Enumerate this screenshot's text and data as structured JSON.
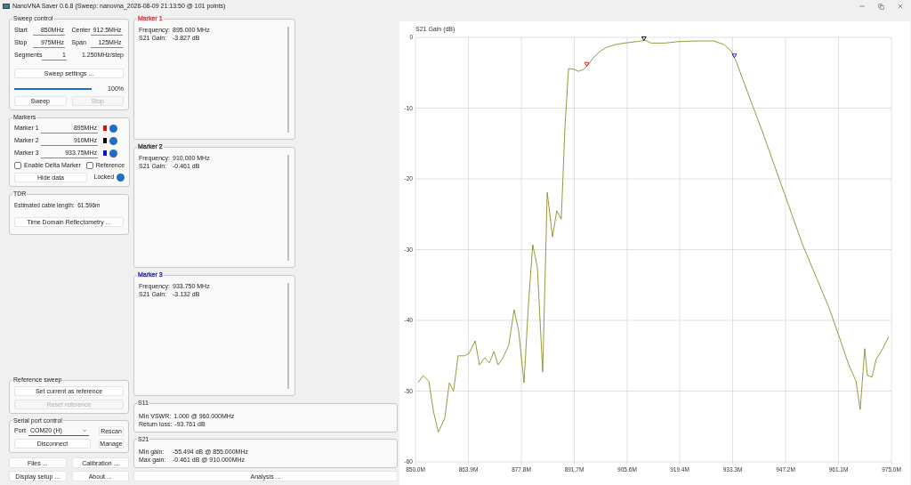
{
  "window": {
    "title": "NanoVNA Saver 0.6.8 (Sweep: nanovna_2026-08-09 21:13:50 @ 101 points)"
  },
  "sweep_control": {
    "title": "Sweep control",
    "fields": [
      {
        "label": "Start",
        "value": "850MHz"
      },
      {
        "label": "Center",
        "value": "912.5MHz"
      },
      {
        "label": "Stop",
        "value": "975MHz"
      },
      {
        "label": "Span",
        "value": "125MHz"
      }
    ],
    "segments": {
      "label": "Segments",
      "value": "1",
      "step": "1.250MHz/step"
    },
    "settings_button": "Sweep settings ...",
    "progress": {
      "level": 1,
      "reading": "100%"
    },
    "buttons": [
      {
        "label": "Sweep",
        "disabled": false
      },
      {
        "label": "Stop",
        "disabled": true
      }
    ]
  },
  "markers": {
    "title": "Markers",
    "items": [
      {
        "label": "Marker 1",
        "value": "895MHz",
        "color": "#e01010"
      },
      {
        "label": "Marker 2",
        "value": "910MHz",
        "color": "#000000"
      },
      {
        "label": "Marker 3",
        "value": "933.75MHz",
        "color": "#1010d0"
      }
    ],
    "checkboxes": [
      {
        "label": "Enable Delta Marker",
        "checked": false
      },
      {
        "label": "Reference",
        "checked": false
      }
    ],
    "hide_button": "Hide data",
    "locked_label": "Locked"
  },
  "tdr": {
    "title": "TDR",
    "text": "Estimated cable length:  61.596m",
    "button": "Time Domain Reflectometry ..."
  },
  "reference_sweep": {
    "title": "Reference sweep",
    "buttons": [
      {
        "label": "Set current as reference",
        "disabled": false
      },
      {
        "label": "Reset reference",
        "disabled": true
      }
    ]
  },
  "serial_port": {
    "title": "Serial port control",
    "port_label": "Port",
    "port_value": "COM20 (H)",
    "buttons": [
      "Rescan",
      "Disconnect",
      "Manage"
    ]
  },
  "bottom_buttons": [
    "Files ...",
    "Calibration ...",
    "Display setup ...",
    "About ..."
  ],
  "marker_panels": [
    {
      "title": "Marker 1",
      "color": "#e04040",
      "rows": [
        {
          "label": "Frequency:",
          "value": "895.000 MHz"
        },
        {
          "label": "S21 Gain:",
          "value": "-3.827 dB"
        }
      ]
    },
    {
      "title": "Marker 2",
      "color": "#404040",
      "rows": [
        {
          "label": "Frequency:",
          "value": "910.000 MHz"
        },
        {
          "label": "S21 Gain:",
          "value": "-0.461 dB"
        }
      ]
    },
    {
      "title": "Marker 3",
      "color": "#3030b0",
      "rows": [
        {
          "label": "Frequency:",
          "value": "933.750 MHz"
        },
        {
          "label": "S21 Gain:",
          "value": "-3.132 dB"
        }
      ]
    }
  ],
  "s11": {
    "title": "S11",
    "rows": [
      {
        "label": "Min VSWR:",
        "value": "1.000 @ 960.000MHz"
      },
      {
        "label": "Return loss:",
        "value": "-93.761 dB"
      }
    ]
  },
  "s21": {
    "title": "S21",
    "rows": [
      {
        "label": "Min gain:",
        "value": "-55.494 dB @ 855.000MHz"
      },
      {
        "label": "Max gain:",
        "value": "-0.461 dB @ 910.000MHz"
      }
    ]
  },
  "analysis_button": "Analysis ...",
  "chart": {
    "chart_data": {
      "type": "line",
      "ylabel": "S21 Gain (dB)",
      "xlim": [
        850,
        975
      ],
      "ylim": [
        -60,
        0
      ],
      "xticks": [
        {
          "value": 850,
          "label": "850.0M"
        },
        {
          "value": 863.9,
          "label": "863.9M"
        },
        {
          "value": 877.8,
          "label": "877.8M"
        },
        {
          "value": 891.7,
          "label": "891.7M"
        },
        {
          "value": 905.6,
          "label": "905.6M"
        },
        {
          "value": 919.4,
          "label": "919.4M"
        },
        {
          "value": 933.3,
          "label": "933.3M"
        },
        {
          "value": 947.2,
          "label": "947.2M"
        },
        {
          "value": 961.1,
          "label": "961.1M"
        },
        {
          "value": 975,
          "label": "975.0M"
        }
      ],
      "yticks": [
        0,
        -10,
        -20,
        -30,
        -40,
        -50,
        -60
      ],
      "x": [
        850.7,
        852,
        853.5,
        854.7,
        856,
        857.7,
        858.9,
        860,
        861.2,
        862.9,
        864,
        865.7,
        866.8,
        868.2,
        869.4,
        870.6,
        871.7,
        872.9,
        874.5,
        875.9,
        877.1,
        878.5,
        879.7,
        880.8,
        882,
        883.4,
        884.6,
        886,
        887.1,
        888.3,
        889.3,
        890.2,
        891.6,
        892.8,
        894.2,
        895.3,
        896.7,
        898.4,
        900.2,
        902.6,
        904.9,
        908,
        910.3,
        911.9,
        915.4,
        918.9,
        923.6,
        928.3,
        931,
        933,
        934.3,
        937.6,
        941.1,
        944.6,
        948.1,
        951.6,
        955.1,
        958.6,
        961.4,
        963.8,
        965.7,
        966.8,
        968,
        968.7,
        969.9,
        971,
        972.7,
        974.3
      ],
      "grid": true,
      "series": [
        {
          "color": "#8c8c2a",
          "values": [
            -48.8,
            -47.8,
            -48.6,
            -52.8,
            -55.8,
            -53.8,
            -48.8,
            -50,
            -45,
            -45,
            -44.7,
            -42.9,
            -46.3,
            -45.3,
            -46,
            -44.4,
            -46.3,
            -45.4,
            -43.5,
            -38.5,
            -41.5,
            -48.8,
            -37.5,
            -29.3,
            -32.5,
            -47.3,
            -21.9,
            -28.2,
            -24.5,
            -25.7,
            -12.3,
            -4.4,
            -4.5,
            -4.8,
            -4.5,
            -3.9,
            -2.9,
            -2,
            -1.4,
            -1,
            -0.8,
            -0.6,
            -0.4,
            -0.8,
            -0.8,
            -0.6,
            -0.5,
            -0.5,
            -1,
            -2,
            -3.5,
            -8.3,
            -13.3,
            -18.6,
            -23.9,
            -29.2,
            -33.7,
            -38.2,
            -42.5,
            -46.3,
            -48.6,
            -52.6,
            -44,
            -47.8,
            -48,
            -45.5,
            -44,
            -42.3
          ]
        }
      ]
    }
  }
}
